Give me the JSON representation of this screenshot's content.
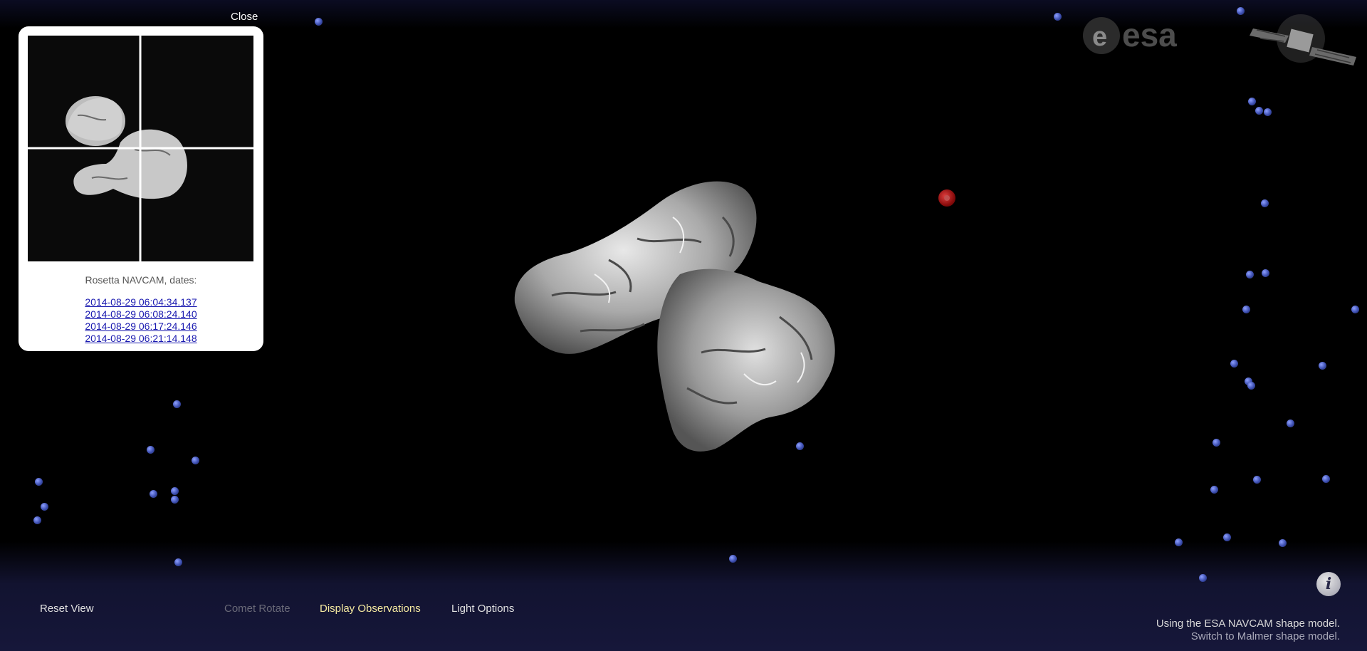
{
  "overlay": {
    "close_label": "Close",
    "panel_title": "Rosetta NAVCAM, dates:",
    "dates": [
      "2014-08-29 06:04:34.137",
      "2014-08-29 06:08:24.140",
      "2014-08-29 06:17:24.146",
      "2014-08-29 06:21:14.148"
    ]
  },
  "toolbar": {
    "reset_view": "Reset View",
    "comet_rotate": "Comet Rotate",
    "display_observations": "Display Observations",
    "light_options": "Light Options"
  },
  "model_info": {
    "current": "Using the ESA NAVCAM shape model.",
    "switch": "Switch to Malmer shape model."
  },
  "logos": {
    "agency": "esa"
  },
  "icons": {
    "info": "info-icon",
    "spacecraft": "spacecraft-icon"
  },
  "colors": {
    "active_toolbar": "#f5e9a0",
    "disabled_toolbar": "#6a6a78",
    "toolbar_text": "#e0e0e0",
    "observation_dot": "#4a5cc8",
    "selected_marker": "#b01818"
  }
}
